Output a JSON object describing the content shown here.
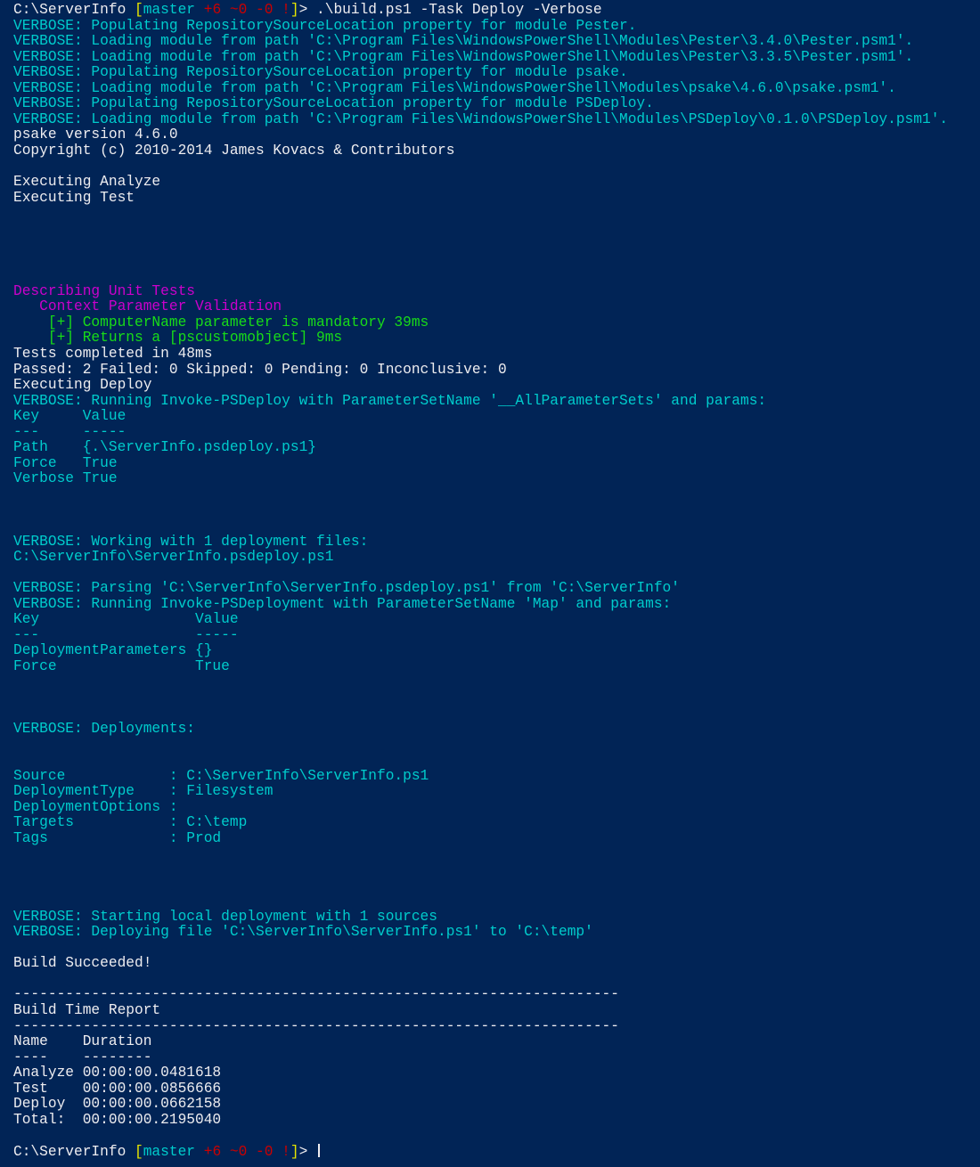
{
  "theme": {
    "background": "#012456",
    "foreground": "#eeedf0",
    "cyan": "#00cccc",
    "magenta": "#cc00cc",
    "green": "#18dc18",
    "yellow": "#e6e600",
    "red": "#cc0000"
  },
  "prompt": {
    "path": "C:\\ServerInfo ",
    "branch": "master",
    "added": "+6",
    "modified": "~0",
    "deleted": "-0",
    "status": "!",
    "end": "> "
  },
  "lines": [
    {
      "segments": [
        {
          "t": "C:\\ServerInfo ",
          "c": "w"
        },
        {
          "t": "[",
          "c": "y"
        },
        {
          "t": "master",
          "c": "c"
        },
        {
          "t": " +6 ~0 -0 !",
          "c": "r"
        },
        {
          "t": "]",
          "c": "y"
        },
        {
          "t": "> .\\build.ps1 -Task Deploy -Verbose",
          "c": "w"
        }
      ]
    },
    {
      "segments": [
        {
          "t": "VERBOSE: Populating RepositorySourceLocation property for module Pester.",
          "c": "c"
        }
      ]
    },
    {
      "segments": [
        {
          "t": "VERBOSE: Loading module from path 'C:\\Program Files\\WindowsPowerShell\\Modules\\Pester\\3.4.0\\Pester.psm1'.",
          "c": "c"
        }
      ]
    },
    {
      "segments": [
        {
          "t": "VERBOSE: Loading module from path 'C:\\Program Files\\WindowsPowerShell\\Modules\\Pester\\3.3.5\\Pester.psm1'.",
          "c": "c"
        }
      ]
    },
    {
      "segments": [
        {
          "t": "VERBOSE: Populating RepositorySourceLocation property for module psake.",
          "c": "c"
        }
      ]
    },
    {
      "segments": [
        {
          "t": "VERBOSE: Loading module from path 'C:\\Program Files\\WindowsPowerShell\\Modules\\psake\\4.6.0\\psake.psm1'.",
          "c": "c"
        }
      ]
    },
    {
      "segments": [
        {
          "t": "VERBOSE: Populating RepositorySourceLocation property for module PSDeploy.",
          "c": "c"
        }
      ]
    },
    {
      "segments": [
        {
          "t": "VERBOSE: Loading module from path 'C:\\Program Files\\WindowsPowerShell\\Modules\\PSDeploy\\0.1.0\\PSDeploy.psm1'.",
          "c": "c"
        }
      ]
    },
    {
      "segments": [
        {
          "t": "psake version 4.6.0",
          "c": "w"
        }
      ]
    },
    {
      "segments": [
        {
          "t": "Copyright (c) 2010-2014 James Kovacs & Contributors",
          "c": "w"
        }
      ]
    },
    {
      "segments": []
    },
    {
      "segments": [
        {
          "t": "Executing Analyze",
          "c": "w"
        }
      ]
    },
    {
      "segments": [
        {
          "t": "Executing Test",
          "c": "w"
        }
      ]
    },
    {
      "segments": []
    },
    {
      "segments": []
    },
    {
      "segments": []
    },
    {
      "segments": []
    },
    {
      "segments": []
    },
    {
      "segments": [
        {
          "t": "Describing Unit Tests",
          "c": "m"
        }
      ]
    },
    {
      "segments": [
        {
          "t": "   Context Parameter Validation",
          "c": "m"
        }
      ]
    },
    {
      "segments": [
        {
          "t": "    [+] ComputerName parameter is mandatory 39ms",
          "c": "g"
        }
      ]
    },
    {
      "segments": [
        {
          "t": "    [+] Returns a [pscustomobject] 9ms",
          "c": "g"
        }
      ]
    },
    {
      "segments": [
        {
          "t": "Tests completed in 48ms",
          "c": "w"
        }
      ]
    },
    {
      "segments": [
        {
          "t": "Passed: 2 Failed: 0 Skipped: 0 Pending: 0 Inconclusive: 0",
          "c": "w"
        }
      ]
    },
    {
      "segments": [
        {
          "t": "Executing Deploy",
          "c": "w"
        }
      ]
    },
    {
      "segments": [
        {
          "t": "VERBOSE: Running Invoke-PSDeploy with ParameterSetName '__AllParameterSets' and params:",
          "c": "c"
        }
      ]
    },
    {
      "segments": [
        {
          "t": "Key     Value",
          "c": "c"
        }
      ]
    },
    {
      "segments": [
        {
          "t": "---     -----",
          "c": "c"
        }
      ]
    },
    {
      "segments": [
        {
          "t": "Path    {.\\ServerInfo.psdeploy.ps1}",
          "c": "c"
        }
      ]
    },
    {
      "segments": [
        {
          "t": "Force   True",
          "c": "c"
        }
      ]
    },
    {
      "segments": [
        {
          "t": "Verbose True",
          "c": "c"
        }
      ]
    },
    {
      "segments": []
    },
    {
      "segments": []
    },
    {
      "segments": []
    },
    {
      "segments": [
        {
          "t": "VERBOSE: Working with 1 deployment files:",
          "c": "c"
        }
      ]
    },
    {
      "segments": [
        {
          "t": "C:\\ServerInfo\\ServerInfo.psdeploy.ps1",
          "c": "c"
        }
      ]
    },
    {
      "segments": []
    },
    {
      "segments": [
        {
          "t": "VERBOSE: Parsing 'C:\\ServerInfo\\ServerInfo.psdeploy.ps1' from 'C:\\ServerInfo'",
          "c": "c"
        }
      ]
    },
    {
      "segments": [
        {
          "t": "VERBOSE: Running Invoke-PSDeployment with ParameterSetName 'Map' and params:",
          "c": "c"
        }
      ]
    },
    {
      "segments": [
        {
          "t": "Key                  Value",
          "c": "c"
        }
      ]
    },
    {
      "segments": [
        {
          "t": "---                  -----",
          "c": "c"
        }
      ]
    },
    {
      "segments": [
        {
          "t": "DeploymentParameters {}",
          "c": "c"
        }
      ]
    },
    {
      "segments": [
        {
          "t": "Force                True",
          "c": "c"
        }
      ]
    },
    {
      "segments": []
    },
    {
      "segments": []
    },
    {
      "segments": []
    },
    {
      "segments": [
        {
          "t": "VERBOSE: Deployments:",
          "c": "c"
        }
      ]
    },
    {
      "segments": []
    },
    {
      "segments": []
    },
    {
      "segments": [
        {
          "t": "Source            : C:\\ServerInfo\\ServerInfo.ps1",
          "c": "c"
        }
      ]
    },
    {
      "segments": [
        {
          "t": "DeploymentType    : Filesystem",
          "c": "c"
        }
      ]
    },
    {
      "segments": [
        {
          "t": "DeploymentOptions :",
          "c": "c"
        }
      ]
    },
    {
      "segments": [
        {
          "t": "Targets           : C:\\temp",
          "c": "c"
        }
      ]
    },
    {
      "segments": [
        {
          "t": "Tags              : Prod",
          "c": "c"
        }
      ]
    },
    {
      "segments": []
    },
    {
      "segments": []
    },
    {
      "segments": []
    },
    {
      "segments": []
    },
    {
      "segments": [
        {
          "t": "VERBOSE: Starting local deployment with 1 sources",
          "c": "c"
        }
      ]
    },
    {
      "segments": [
        {
          "t": "VERBOSE: Deploying file 'C:\\ServerInfo\\ServerInfo.ps1' to 'C:\\temp'",
          "c": "c"
        }
      ]
    },
    {
      "segments": []
    },
    {
      "segments": [
        {
          "t": "Build Succeeded!",
          "c": "w"
        }
      ]
    },
    {
      "segments": []
    },
    {
      "segments": [
        {
          "t": "----------------------------------------------------------------------",
          "c": "w"
        }
      ]
    },
    {
      "segments": [
        {
          "t": "Build Time Report",
          "c": "w"
        }
      ]
    },
    {
      "segments": [
        {
          "t": "----------------------------------------------------------------------",
          "c": "w"
        }
      ]
    },
    {
      "segments": [
        {
          "t": "Name    Duration",
          "c": "w"
        }
      ]
    },
    {
      "segments": [
        {
          "t": "----    --------",
          "c": "w"
        }
      ]
    },
    {
      "segments": [
        {
          "t": "Analyze 00:00:00.0481618",
          "c": "w"
        }
      ]
    },
    {
      "segments": [
        {
          "t": "Test    00:00:00.0856666",
          "c": "w"
        }
      ]
    },
    {
      "segments": [
        {
          "t": "Deploy  00:00:00.0662158",
          "c": "w"
        }
      ]
    },
    {
      "segments": [
        {
          "t": "Total:  00:00:00.2195040",
          "c": "w"
        }
      ]
    },
    {
      "segments": []
    },
    {
      "segments": [
        {
          "t": "C:\\ServerInfo ",
          "c": "w"
        },
        {
          "t": "[",
          "c": "y"
        },
        {
          "t": "master",
          "c": "c"
        },
        {
          "t": " +6 ~0 -0 !",
          "c": "r"
        },
        {
          "t": "]",
          "c": "y"
        },
        {
          "t": "> ",
          "c": "w"
        }
      ],
      "cursor": true
    }
  ]
}
